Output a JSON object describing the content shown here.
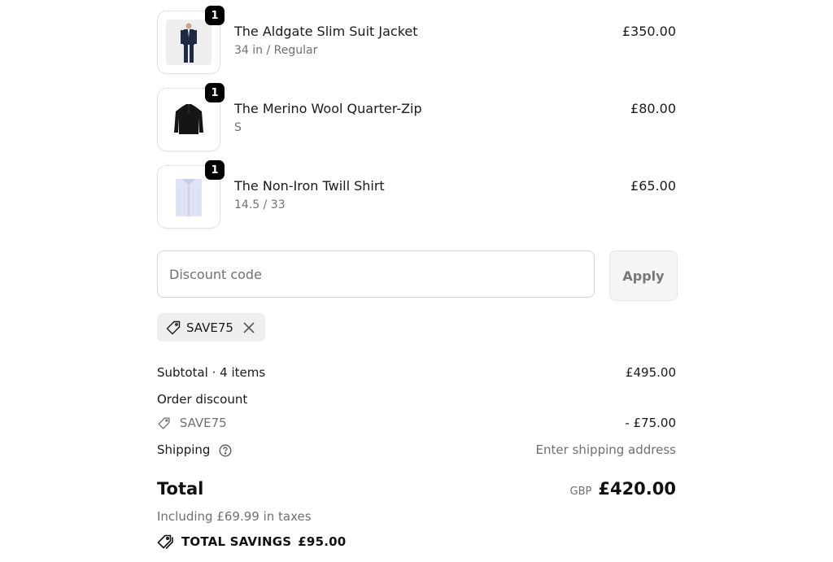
{
  "items": [
    {
      "name": "The Aldgate Slim Suit Jacket",
      "variant": "34 in / Regular",
      "price": "£350.00",
      "quantity": "1",
      "icon": "suit-jacket-image"
    },
    {
      "name": "The Merino Wool Quarter-Zip",
      "variant": "S",
      "price": "£80.00",
      "quantity": "1",
      "icon": "quarter-zip-image"
    },
    {
      "name": "The Non-Iron Twill Shirt",
      "variant": "14.5 / 33",
      "price": "£65.00",
      "quantity": "1",
      "icon": "shirt-image"
    }
  ],
  "discount": {
    "placeholder": "Discount code",
    "value": "",
    "apply_label": "Apply",
    "applied_code": "SAVE75"
  },
  "summary": {
    "subtotal_label": "Subtotal · 4 items",
    "subtotal_value": "£495.00",
    "order_discount_label": "Order discount",
    "order_discount_code": "SAVE75",
    "order_discount_value": "- £75.00",
    "shipping_label": "Shipping",
    "shipping_value": "Enter shipping address",
    "total_label": "Total",
    "currency": "GBP",
    "total_value": "£420.00",
    "tax_note": "Including £69.99 in taxes",
    "savings_label": "TOTAL SAVINGS",
    "savings_value": "£95.00"
  },
  "colors": {
    "text": "#111111",
    "muted": "#707070",
    "badge": "#000000",
    "chip_bg": "#efefef"
  }
}
